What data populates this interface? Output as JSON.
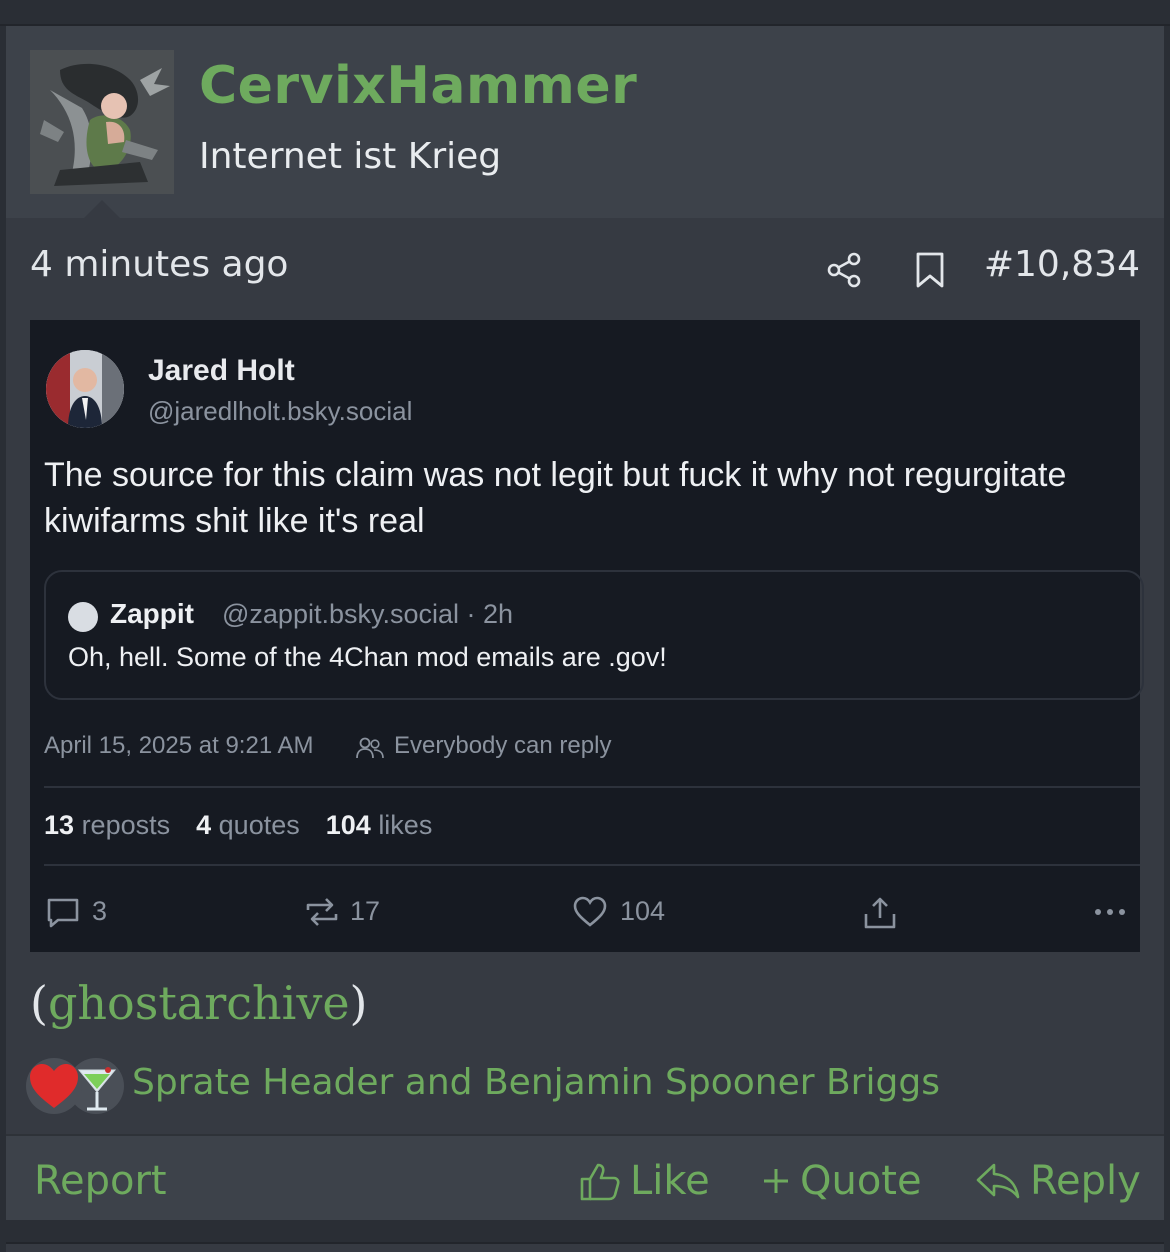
{
  "post": {
    "username": "CervixHammer",
    "user_title": "Internet ist Krieg",
    "timestamp": "4 minutes ago",
    "post_number": "#10,834",
    "icons": {
      "share": "share-icon",
      "bookmark": "bookmark-icon"
    }
  },
  "embed": {
    "author_name": "Jared Holt",
    "author_handle": "@jaredlholt.bsky.social",
    "text": "The source for this claim was not legit but fuck it why not regurgitate kiwifarms shit like it's real",
    "quote": {
      "name": "Zappit",
      "handle_time": "@zappit.bsky.social · 2h",
      "text": "Oh, hell. Some of the 4Chan mod emails are .gov!"
    },
    "date": "April 15, 2025 at 9:21 AM",
    "reply_setting": "Everybody can reply",
    "stats": {
      "reposts_count": "13",
      "reposts_label": "reposts",
      "quotes_count": "4",
      "quotes_label": "quotes",
      "likes_count": "104",
      "likes_label": "likes"
    },
    "actions": {
      "replies": "3",
      "reposts": "17",
      "likes": "104"
    }
  },
  "body": {
    "open_paren": "(",
    "link_text": "ghostarchive",
    "close_paren": ")"
  },
  "reactions": {
    "icons": [
      "heart-reaction",
      "cocktail-reaction"
    ],
    "users": "Sprate Header and Benjamin Spooner Briggs"
  },
  "footer": {
    "report": "Report",
    "like": "Like",
    "quote": "Quote",
    "reply": "Reply"
  },
  "colors": {
    "accent_green": "#6eaa5e",
    "post_bg": "#363a42",
    "header_bg": "#3d424a",
    "embed_bg": "#161a22"
  }
}
